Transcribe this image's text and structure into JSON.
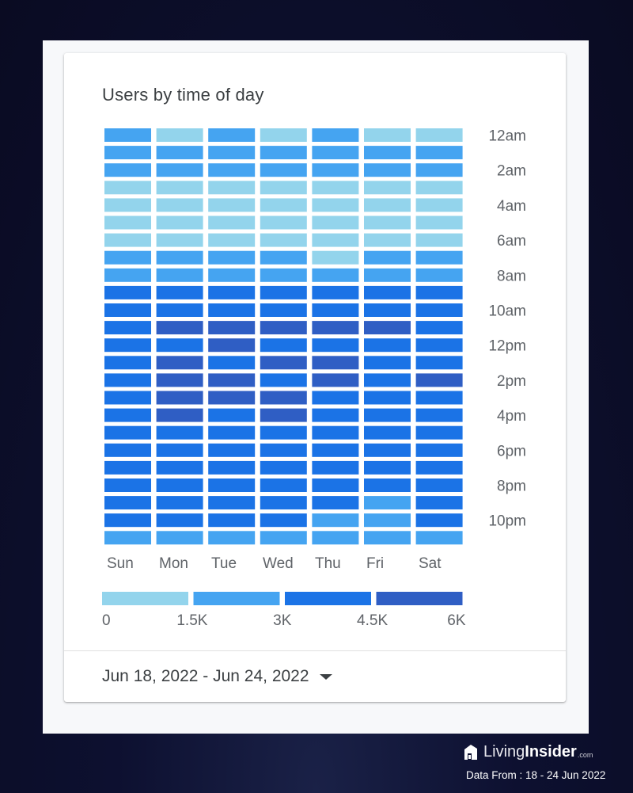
{
  "card": {
    "title": "Users by time of day",
    "date_range": "Jun 18, 2022 - Jun 24, 2022",
    "date_range_icon": "caret-down-icon"
  },
  "chart_data": {
    "type": "heatmap",
    "title": "Users by time of day",
    "x_categories": [
      "Sun",
      "Mon",
      "Tue",
      "Wed",
      "Thu",
      "Fri",
      "Sat"
    ],
    "y_categories": [
      "12am",
      "1am",
      "2am",
      "3am",
      "4am",
      "5am",
      "6am",
      "7am",
      "8am",
      "9am",
      "10am",
      "11am",
      "12pm",
      "1pm",
      "2pm",
      "3pm",
      "4pm",
      "5pm",
      "6pm",
      "7pm",
      "8pm",
      "9pm",
      "10pm",
      "11pm"
    ],
    "y_tick_labels": [
      "12am",
      "2am",
      "4am",
      "6am",
      "8am",
      "10am",
      "12pm",
      "2pm",
      "4pm",
      "6pm",
      "8pm",
      "10pm"
    ],
    "y_axis_position": "right",
    "value_bins": [
      {
        "range": "0-1.5K",
        "color": "#93d4ec"
      },
      {
        "range": "1.5K-3K",
        "color": "#45a4f1"
      },
      {
        "range": "3K-4.5K",
        "color": "#1b73e6"
      },
      {
        "range": "4.5K-6K",
        "color": "#2f5ec4"
      }
    ],
    "legend": {
      "ticks": [
        "0",
        "1.5K",
        "3K",
        "4.5K",
        "6K"
      ],
      "position": "bottom"
    },
    "value_note": "Cell values are color bin indices (0=0-1.5K, 1=1.5K-3K, 2=3K-4.5K, 3=4.5K-6K); rows are hours, columns are days",
    "values": [
      [
        1,
        0,
        1,
        0,
        1,
        0,
        0
      ],
      [
        1,
        1,
        1,
        1,
        1,
        1,
        1
      ],
      [
        1,
        1,
        1,
        1,
        1,
        1,
        1
      ],
      [
        0,
        0,
        0,
        0,
        0,
        0,
        0
      ],
      [
        0,
        0,
        0,
        0,
        0,
        0,
        0
      ],
      [
        0,
        0,
        0,
        0,
        0,
        0,
        0
      ],
      [
        0,
        0,
        0,
        0,
        0,
        0,
        0
      ],
      [
        1,
        1,
        1,
        1,
        0,
        1,
        1
      ],
      [
        1,
        1,
        1,
        1,
        1,
        1,
        1
      ],
      [
        2,
        2,
        2,
        2,
        2,
        2,
        2
      ],
      [
        2,
        2,
        2,
        2,
        2,
        2,
        2
      ],
      [
        2,
        3,
        3,
        3,
        3,
        3,
        2
      ],
      [
        2,
        2,
        3,
        2,
        2,
        2,
        2
      ],
      [
        2,
        3,
        2,
        3,
        3,
        2,
        2
      ],
      [
        2,
        3,
        3,
        2,
        3,
        2,
        3
      ],
      [
        2,
        3,
        3,
        3,
        2,
        2,
        2
      ],
      [
        2,
        3,
        2,
        3,
        2,
        2,
        2
      ],
      [
        2,
        2,
        2,
        2,
        2,
        2,
        2
      ],
      [
        2,
        2,
        2,
        2,
        2,
        2,
        2
      ],
      [
        2,
        2,
        2,
        2,
        2,
        2,
        2
      ],
      [
        2,
        2,
        2,
        2,
        2,
        2,
        2
      ],
      [
        2,
        2,
        2,
        2,
        2,
        1,
        2
      ],
      [
        2,
        2,
        2,
        2,
        1,
        1,
        2
      ],
      [
        1,
        1,
        1,
        1,
        1,
        1,
        1
      ]
    ]
  },
  "footer": {
    "brand_living": "Living",
    "brand_insider": "Insider",
    "brand_com": ".com",
    "data_from": "Data From : 18 -  24 Jun 2022"
  }
}
